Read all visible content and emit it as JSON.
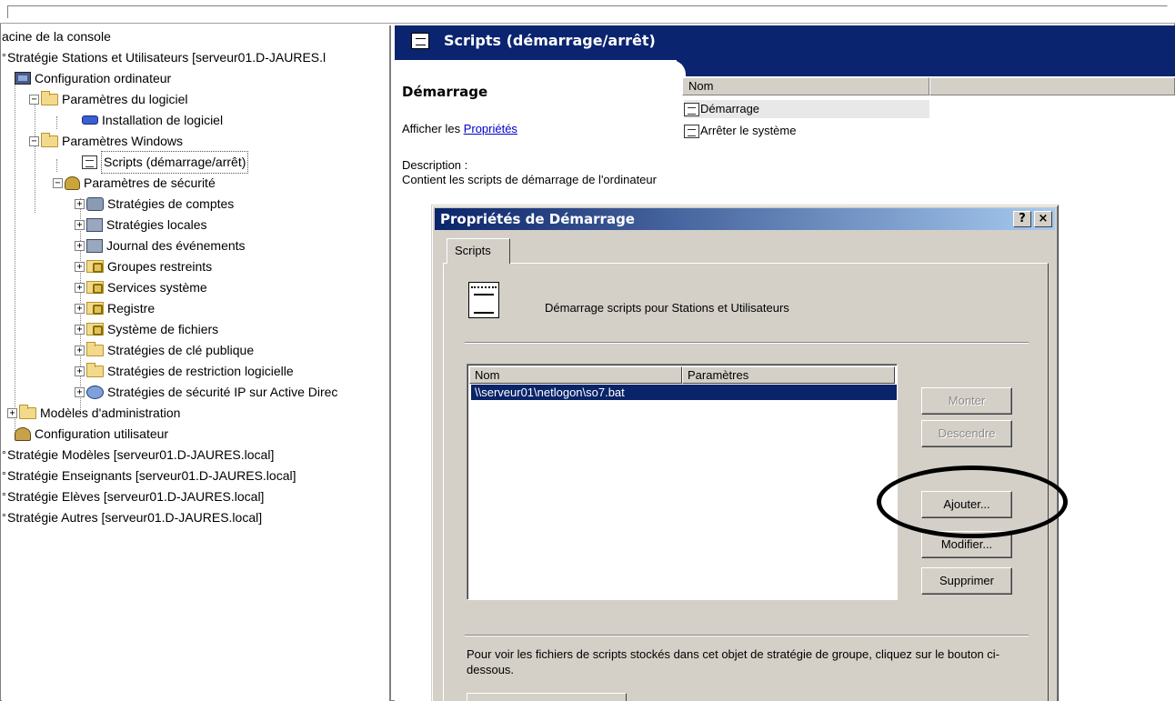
{
  "tree": {
    "items": [
      {
        "label": "acine de la console"
      },
      {
        "label": "Stratégie Stations et Utilisateurs [serveur01.D-JAURES.l"
      },
      {
        "label": "Configuration ordinateur"
      },
      {
        "label": "Paramètres du logiciel"
      },
      {
        "label": "Installation de logiciel"
      },
      {
        "label": "Paramètres Windows"
      },
      {
        "label": "Scripts (démarrage/arrêt)"
      },
      {
        "label": "Paramètres de sécurité"
      },
      {
        "label": "Stratégies de comptes"
      },
      {
        "label": "Stratégies locales"
      },
      {
        "label": "Journal des événements"
      },
      {
        "label": "Groupes restreints"
      },
      {
        "label": "Services système"
      },
      {
        "label": "Registre"
      },
      {
        "label": "Système de fichiers"
      },
      {
        "label": "Stratégies de clé publique"
      },
      {
        "label": "Stratégies de restriction logicielle"
      },
      {
        "label": "Stratégies de sécurité IP sur Active Direc"
      },
      {
        "label": "Modèles d'administration"
      },
      {
        "label": "Configuration utilisateur"
      },
      {
        "label": "Stratégie Modèles [serveur01.D-JAURES.local]"
      },
      {
        "label": "Stratégie Enseignants [serveur01.D-JAURES.local]"
      },
      {
        "label": "Stratégie Elèves [serveur01.D-JAURES.local]"
      },
      {
        "label": "Stratégie Autres [serveur01.D-JAURES.local]"
      }
    ]
  },
  "right": {
    "banner_title": "Scripts (démarrage/arrêt)",
    "desc_title": "Démarrage",
    "afficher_prefix": "Afficher les ",
    "afficher_link": "Propriétés",
    "description_label": "Description :",
    "description_text": "Contient les scripts de démarrage de l'ordinateur",
    "list": {
      "col_name": "Nom",
      "rows": [
        "Démarrage",
        "Arrêter le système"
      ]
    }
  },
  "dialog": {
    "title": "Propriétés de Démarrage",
    "help_btn": "?",
    "close_btn": "×",
    "tab_label": "Scripts",
    "heading": "Démarrage scripts pour Stations et Utilisateurs",
    "columns": [
      "Nom",
      "Paramètres"
    ],
    "rows": [
      "\\\\serveur01\\netlogon\\so7.bat"
    ],
    "buttons": {
      "monter": "Monter",
      "descendre": "Descendre",
      "ajouter": "Ajouter...",
      "modifier": "Modifier...",
      "supprimer": "Supprimer"
    },
    "footer_text": "Pour voir les fichiers de scripts stockés dans cet objet de stratégie de groupe, cliquez sur le bouton ci-dessous."
  }
}
